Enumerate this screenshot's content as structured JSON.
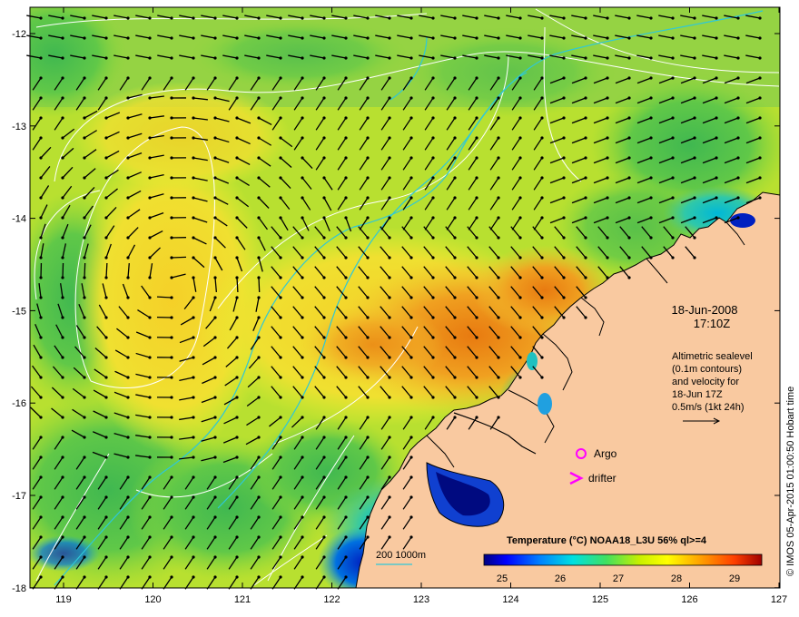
{
  "map": {
    "date": "18-Jun-2008",
    "time": "17:10Z",
    "annotation_lines": [
      "Altimetric sealevel",
      "(0.1m contours)",
      "and velocity for",
      "18-Jun 17Z",
      "0.5m/s (1kt 24h)"
    ],
    "argo_label": "Argo",
    "drifter_label": "drifter",
    "depth_label": "200  1000m",
    "credit": "© IMOS 05-Apr-2015 01:00:50 Hobart time",
    "colorbar": {
      "title": "Temperature (°C) NOAA18_L3U 56% ql>=4",
      "ticks": [
        "25",
        "26",
        "27",
        "28",
        "29"
      ]
    },
    "lon_ticks": [
      "119",
      "120",
      "121",
      "122",
      "123",
      "124",
      "125",
      "126",
      "127"
    ],
    "lat_ticks": [
      "-12",
      "-13",
      "-14",
      "-15",
      "-16",
      "-17",
      "-18"
    ],
    "colors": {
      "land": "#f9c9a0",
      "argo": "#ff00ff",
      "drifter": "#ff00ff",
      "contour": "#ffffff",
      "isobath": "#2ec8d8"
    }
  }
}
